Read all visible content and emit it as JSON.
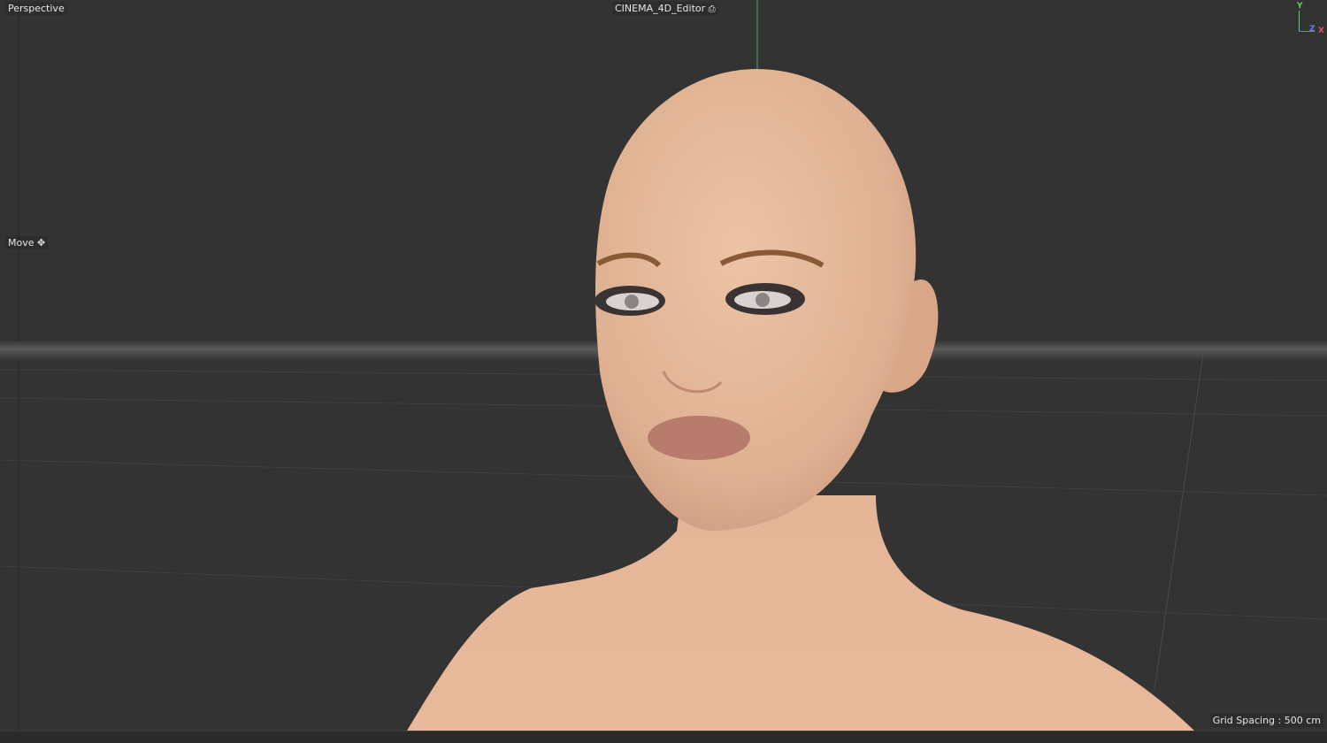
{
  "viewport": {
    "camera_name": "Perspective",
    "camera_label": "CINEMA_4D_Editor",
    "tool_name": "Move",
    "grid_spacing": "Grid Spacing : 500 cm",
    "axes": {
      "y": "Y",
      "z": "Z",
      "x": "X"
    }
  },
  "colors": {
    "background": "#333333",
    "skin": "#e2b595",
    "y_axis": "#5fcf6a",
    "x_axis": "#e0505a",
    "z_axis": "#6a7be0"
  }
}
